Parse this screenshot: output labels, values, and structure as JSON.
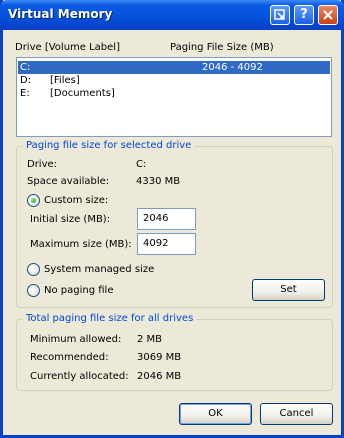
{
  "window": {
    "title": "Virtual Memory"
  },
  "titlebar_buttons": [
    "help-icon",
    "close-icon",
    "arrow-icon"
  ],
  "list": {
    "header_drive": "Drive  [Volume Label]",
    "header_size": "Paging File Size (MB)",
    "rows": [
      {
        "drive": "C:",
        "label": "",
        "size": "2046 - 4092"
      },
      {
        "drive": "D:",
        "label": "[Files]",
        "size": ""
      },
      {
        "drive": "E:",
        "label": "[Documents]",
        "size": ""
      }
    ]
  },
  "selected": {
    "legend": "Paging file size for selected drive",
    "drive_label": "Drive:",
    "drive_value": "C:",
    "space_label": "Space available:",
    "space_value": "4330 MB",
    "custom_label": "Custom size:",
    "initial_label": "Initial size (MB):",
    "initial_value": "2046",
    "maximum_label": "Maximum size (MB):",
    "maximum_value": "4092",
    "system_label": "System managed size",
    "nopaging_label": "No paging file",
    "set_label": "Set"
  },
  "total": {
    "legend": "Total paging file size for all drives",
    "min_label": "Minimum allowed:",
    "min_value": "2 MB",
    "rec_label": "Recommended:",
    "rec_value": "3069 MB",
    "cur_label": "Currently allocated:",
    "cur_value": "2046 MB"
  },
  "buttons": {
    "ok": "OK",
    "cancel": "Cancel"
  }
}
